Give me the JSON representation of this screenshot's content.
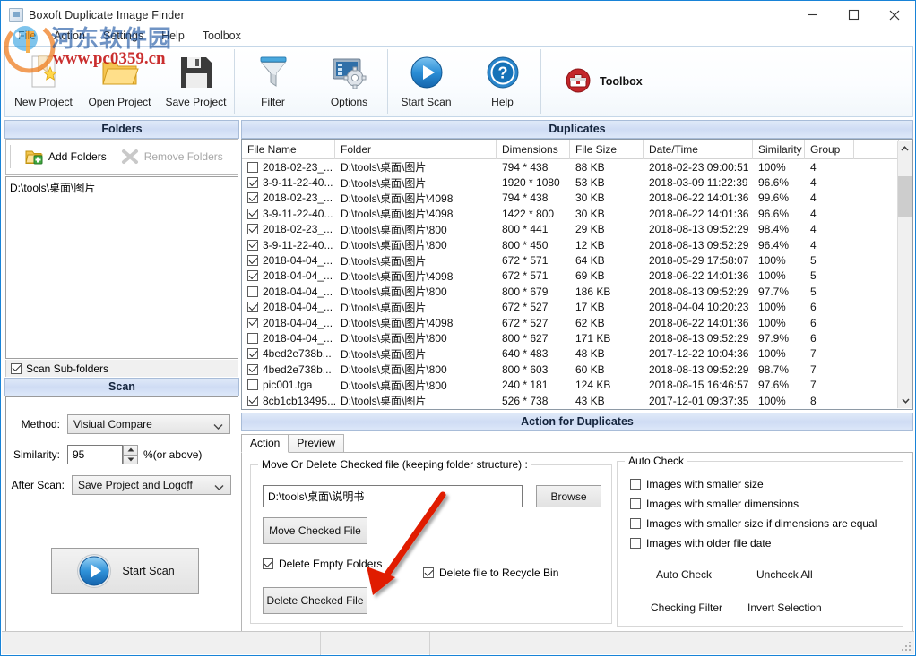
{
  "window": {
    "title": "Boxoft Duplicate Image Finder",
    "minimize": "─",
    "maximize": "□",
    "close": "✕"
  },
  "watermark": {
    "cn": "河东软件园",
    "url": "www.pc0359.cn"
  },
  "menu": {
    "items": [
      "File",
      "Action",
      "Settings",
      "Help",
      "Toolbox"
    ]
  },
  "toolbar": {
    "buttons": [
      {
        "label": "New Project",
        "icon": "new-project-icon"
      },
      {
        "label": "Open Project",
        "icon": "open-project-icon"
      },
      {
        "label": "Save Project",
        "icon": "save-project-icon"
      },
      {
        "label": "Filter",
        "icon": "filter-icon"
      },
      {
        "label": "Options",
        "icon": "options-icon"
      },
      {
        "label": "Start Scan",
        "icon": "start-scan-icon"
      },
      {
        "label": "Help",
        "icon": "help-icon"
      },
      {
        "label": "Toolbox",
        "icon": "toolbox-icon"
      }
    ]
  },
  "folders": {
    "header": "Folders",
    "add_label": "Add Folders",
    "remove_label": "Remove Folders",
    "list": [
      "D:\\tools\\桌面\\图片"
    ],
    "scan_subfolders_label": "Scan Sub-folders",
    "scan_subfolders_checked": true
  },
  "scan": {
    "header": "Scan",
    "method_label": "Method:",
    "method_value": "Visiual Compare",
    "similarity_label": "Similarity:",
    "similarity_value": "95",
    "similarity_suffix": "%(or above)",
    "after_scan_label": "After Scan:",
    "after_scan_value": "Save Project and Logoff",
    "start_scan_label": "Start Scan"
  },
  "duplicates": {
    "header": "Duplicates",
    "columns": [
      "File Name",
      "Folder",
      "Dimensions",
      "File Size",
      "Date/Time",
      "Similarity",
      "Group"
    ],
    "rows": [
      {
        "checked": false,
        "name": "2018-02-23_...",
        "folder": "D:\\tools\\桌面\\图片",
        "dim": "794 * 438",
        "size": "88 KB",
        "date": "2018-02-23 09:00:51",
        "sim": "100%",
        "group": "4"
      },
      {
        "checked": true,
        "name": "3-9-11-22-40...",
        "folder": "D:\\tools\\桌面\\图片",
        "dim": "1920 * 1080",
        "size": "53 KB",
        "date": "2018-03-09 11:22:39",
        "sim": "96.6%",
        "group": "4"
      },
      {
        "checked": true,
        "name": "2018-02-23_...",
        "folder": "D:\\tools\\桌面\\图片\\4098",
        "dim": "794 * 438",
        "size": "30 KB",
        "date": "2018-06-22 14:01:36",
        "sim": "99.6%",
        "group": "4"
      },
      {
        "checked": true,
        "name": "3-9-11-22-40...",
        "folder": "D:\\tools\\桌面\\图片\\4098",
        "dim": "1422 * 800",
        "size": "30 KB",
        "date": "2018-06-22 14:01:36",
        "sim": "96.6%",
        "group": "4"
      },
      {
        "checked": true,
        "name": "2018-02-23_...",
        "folder": "D:\\tools\\桌面\\图片\\800",
        "dim": "800 * 441",
        "size": "29 KB",
        "date": "2018-08-13 09:52:29",
        "sim": "98.4%",
        "group": "4"
      },
      {
        "checked": true,
        "name": "3-9-11-22-40...",
        "folder": "D:\\tools\\桌面\\图片\\800",
        "dim": "800 * 450",
        "size": "12 KB",
        "date": "2018-08-13 09:52:29",
        "sim": "96.4%",
        "group": "4"
      },
      {
        "checked": true,
        "name": "2018-04-04_...",
        "folder": "D:\\tools\\桌面\\图片",
        "dim": "672 * 571",
        "size": "64 KB",
        "date": "2018-05-29 17:58:07",
        "sim": "100%",
        "group": "5"
      },
      {
        "checked": true,
        "name": "2018-04-04_...",
        "folder": "D:\\tools\\桌面\\图片\\4098",
        "dim": "672 * 571",
        "size": "69 KB",
        "date": "2018-06-22 14:01:36",
        "sim": "100%",
        "group": "5"
      },
      {
        "checked": false,
        "name": "2018-04-04_...",
        "folder": "D:\\tools\\桌面\\图片\\800",
        "dim": "800 * 679",
        "size": "186 KB",
        "date": "2018-08-13 09:52:29",
        "sim": "97.7%",
        "group": "5"
      },
      {
        "checked": true,
        "name": "2018-04-04_...",
        "folder": "D:\\tools\\桌面\\图片",
        "dim": "672 * 527",
        "size": "17 KB",
        "date": "2018-04-04 10:20:23",
        "sim": "100%",
        "group": "6"
      },
      {
        "checked": true,
        "name": "2018-04-04_...",
        "folder": "D:\\tools\\桌面\\图片\\4098",
        "dim": "672 * 527",
        "size": "62 KB",
        "date": "2018-06-22 14:01:36",
        "sim": "100%",
        "group": "6"
      },
      {
        "checked": false,
        "name": "2018-04-04_...",
        "folder": "D:\\tools\\桌面\\图片\\800",
        "dim": "800 * 627",
        "size": "171 KB",
        "date": "2018-08-13 09:52:29",
        "sim": "97.9%",
        "group": "6"
      },
      {
        "checked": true,
        "name": "4bed2e738b...",
        "folder": "D:\\tools\\桌面\\图片",
        "dim": "640 * 483",
        "size": "48 KB",
        "date": "2017-12-22 10:04:36",
        "sim": "100%",
        "group": "7"
      },
      {
        "checked": true,
        "name": "4bed2e738b...",
        "folder": "D:\\tools\\桌面\\图片\\800",
        "dim": "800 * 603",
        "size": "60 KB",
        "date": "2018-08-13 09:52:29",
        "sim": "98.7%",
        "group": "7"
      },
      {
        "checked": false,
        "name": "pic001.tga",
        "folder": "D:\\tools\\桌面\\图片\\800",
        "dim": "240 * 181",
        "size": "124 KB",
        "date": "2018-08-15 16:46:57",
        "sim": "97.6%",
        "group": "7"
      },
      {
        "checked": true,
        "name": "8cb1cb13495...",
        "folder": "D:\\tools\\桌面\\图片",
        "dim": "526 * 738",
        "size": "43 KB",
        "date": "2017-12-01 09:37:35",
        "sim": "100%",
        "group": "8"
      }
    ]
  },
  "action": {
    "header": "Action for Duplicates",
    "tabs": [
      {
        "label": "Action",
        "active": true
      },
      {
        "label": "Preview",
        "active": false
      }
    ],
    "move_group_legend": "Move Or Delete Checked file (keeping folder structure) :",
    "target_path": "D:\\tools\\桌面\\说明书",
    "browse_label": "Browse",
    "move_checked_label": "Move Checked File",
    "delete_empty_label": "Delete Empty Folders",
    "delete_empty_checked": true,
    "recycle_label": "Delete file to Recycle Bin",
    "recycle_checked": true,
    "delete_checked_label": "Delete Checked File",
    "auto_check": {
      "legend": "Auto Check",
      "options": [
        {
          "label": "Images with smaller size",
          "checked": false
        },
        {
          "label": "Images with smaller dimensions",
          "checked": false
        },
        {
          "label": "Images with smaller size if dimensions are equal",
          "checked": false
        },
        {
          "label": "Images with older file date",
          "checked": false
        }
      ],
      "auto_check_label": "Auto Check",
      "uncheck_all_label": "Uncheck All",
      "checking_filter_label": "Checking Filter",
      "invert_selection_label": "Invert Selection"
    }
  },
  "statusbar": {
    "cells": [
      "",
      "",
      ""
    ]
  },
  "colors": {
    "window_border": "#1883d7",
    "panel_header_bg": "#cfdcf4",
    "accent_blue": "#1b74c8",
    "annotation_red": "#e01b00"
  }
}
